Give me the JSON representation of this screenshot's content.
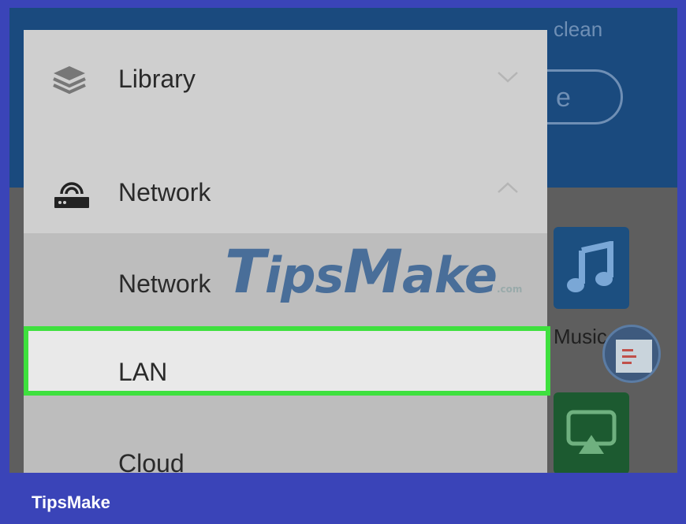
{
  "background_app": {
    "partial_text_top": "clean",
    "partial_button_text": "e",
    "music_label": "Music"
  },
  "drawer": {
    "items": [
      {
        "label": "Library",
        "icon": "layers-icon",
        "chevron": "chevron-down-icon"
      },
      {
        "label": "Network",
        "icon": "router-icon",
        "chevron": "chevron-up-icon"
      }
    ],
    "network_submenu": [
      {
        "label": "Network"
      },
      {
        "label": "LAN",
        "highlighted": true
      },
      {
        "label": "Cloud"
      }
    ]
  },
  "watermark": {
    "text_first": "T",
    "text_mid": "ips",
    "text_cap": "M",
    "text_end": "ake",
    "suffix": ".com"
  },
  "footer": {
    "brand": "TipsMake"
  },
  "colors": {
    "frame_border": "#3a44b8",
    "highlight": "#3ee03e",
    "drawer_bg": "#cfcfcf",
    "app_blue": "#1a4a7e"
  }
}
